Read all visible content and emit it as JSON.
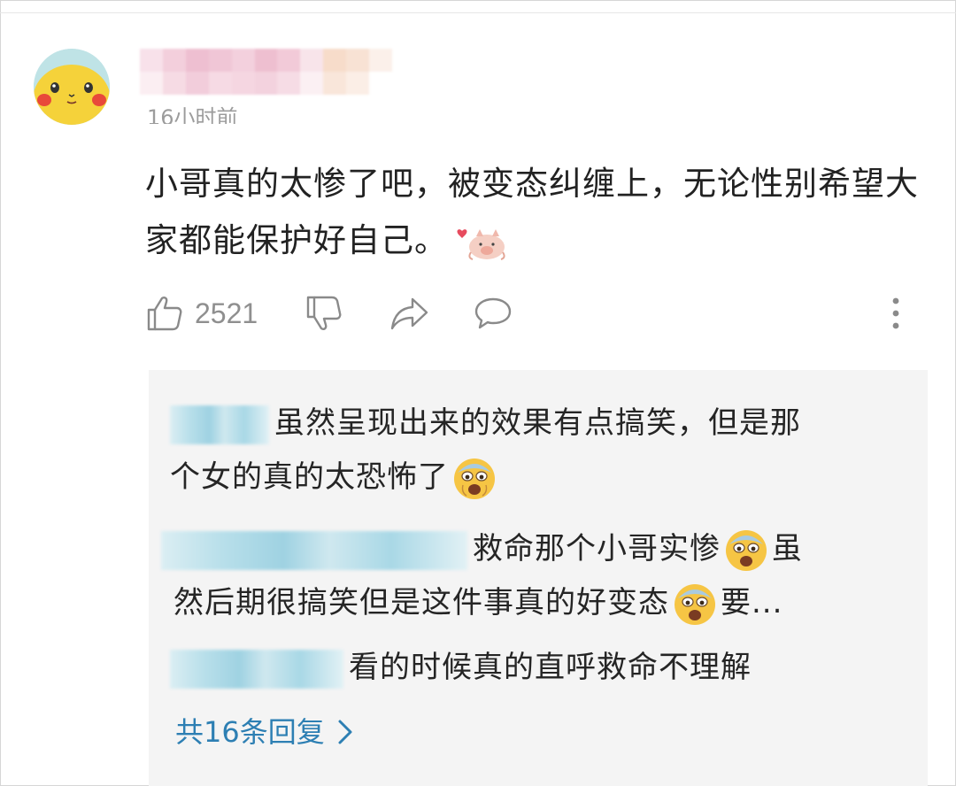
{
  "comment": {
    "time": "16小时前",
    "text": "小哥真的太惨了吧，被变态纠缠上，无论性别希望大家都能保护好自己。",
    "sticker": "pink-pig-heart-sticker",
    "like_count": "2521"
  },
  "actions": {
    "like_icon": "thumbs-up-icon",
    "dislike_icon": "thumbs-down-icon",
    "share_icon": "share-arrow-icon",
    "reply_icon": "speech-bubble-icon",
    "more_icon": "vertical-dots-icon"
  },
  "replies": [
    {
      "text_a": "虽然呈现出来的效果有点搞笑，但是那",
      "text_b": "个女的真的太恐怖了"
    },
    {
      "text_a": "救命那个小哥实惨",
      "text_b": "虽",
      "text_c": "然后期很搞笑但是这件事真的好变态",
      "text_d": "要..."
    },
    {
      "text_a": "看的时候真的直呼救命不理解"
    }
  ],
  "more_replies": "共16条回复",
  "colors": {
    "link": "#2d7fb3",
    "reply_bg": "#f4f4f4",
    "text": "#222222",
    "muted": "#8a8a8a"
  }
}
